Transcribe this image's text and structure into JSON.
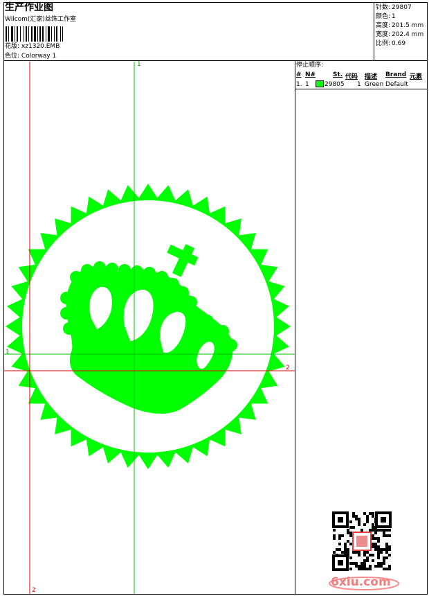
{
  "header": {
    "title": "生产作业图",
    "company": "Wilcom(汇家)丝饰工作室",
    "design_label": "花版:",
    "design_value": "xz1320.EMB",
    "colorway_label": "色位:",
    "colorway_value": "Colorway 1"
  },
  "stats": [
    {
      "label": "针数:",
      "value": "29807"
    },
    {
      "label": "颜色:",
      "value": "1"
    },
    {
      "label": "高度:",
      "value": "201.5 mm"
    },
    {
      "label": "宽度:",
      "value": "202.4 mm"
    },
    {
      "label": "比例:",
      "value": "0.69"
    }
  ],
  "stop_sequence": {
    "title": "停止顺序:",
    "columns": [
      "#",
      "N#",
      "St.",
      "代码",
      "描述",
      "Brand",
      "元素"
    ],
    "rows": [
      {
        "index": "1.",
        "n": "1",
        "swatch_color": "#00ff00",
        "stitches": "29805",
        "code": "1",
        "description": "Green",
        "brand": "Default",
        "element": ""
      }
    ]
  },
  "axes": {
    "green_top": "1",
    "green_left": "1",
    "red_right": "2",
    "red_bottom": "2"
  },
  "colors": {
    "stitch_green": "#00ff00",
    "axis_green": "#00c000",
    "axis_red": "#e00000"
  },
  "watermark": {
    "site": "6xiu.com"
  }
}
